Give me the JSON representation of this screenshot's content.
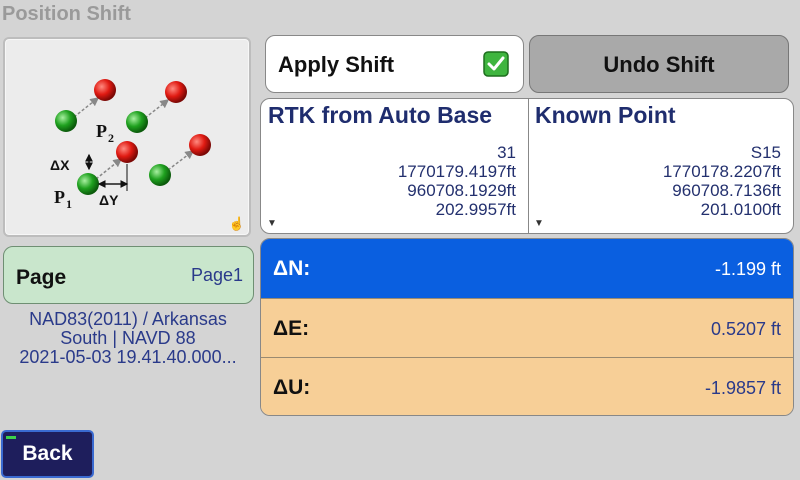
{
  "app": {
    "title": "Position Shift"
  },
  "diagram": {
    "p1_label": "P",
    "p1_sub": "1",
    "p2_label": "P",
    "p2_sub": "2",
    "dx_label": "ΔX",
    "dy_label": "ΔY"
  },
  "buttons": {
    "apply_label": "Apply Shift",
    "undo_label": "Undo Shift",
    "back_label": "Back"
  },
  "points": {
    "source": {
      "header": "RTK from Auto Base",
      "name": "31",
      "northing": "1770179.4197ft",
      "easting": "960708.1929ft",
      "elevation": "202.9957ft"
    },
    "target": {
      "header": "Known Point",
      "name": "S15",
      "northing": "1770178.2207ft",
      "easting": "960708.7136ft",
      "elevation": "201.0100ft"
    }
  },
  "page": {
    "label": "Page",
    "value": "Page1"
  },
  "info": {
    "line1": "NAD83(2011) / Arkansas",
    "line2": "South | NAVD 88",
    "line3": "2021-05-03 19.41.40.000..."
  },
  "deltas": {
    "n": {
      "label": "ΔN:",
      "value": "-1.199 ft"
    },
    "e": {
      "label": "ΔE:",
      "value": "0.5207 ft"
    },
    "u": {
      "label": "ΔU:",
      "value": "-1.9857 ft"
    }
  },
  "colors": {
    "highlight_row": "#0a5fe0",
    "delta_row": "#f7cf97",
    "page_box": "#c9e6cc",
    "back_button": "#1e1e5c"
  }
}
